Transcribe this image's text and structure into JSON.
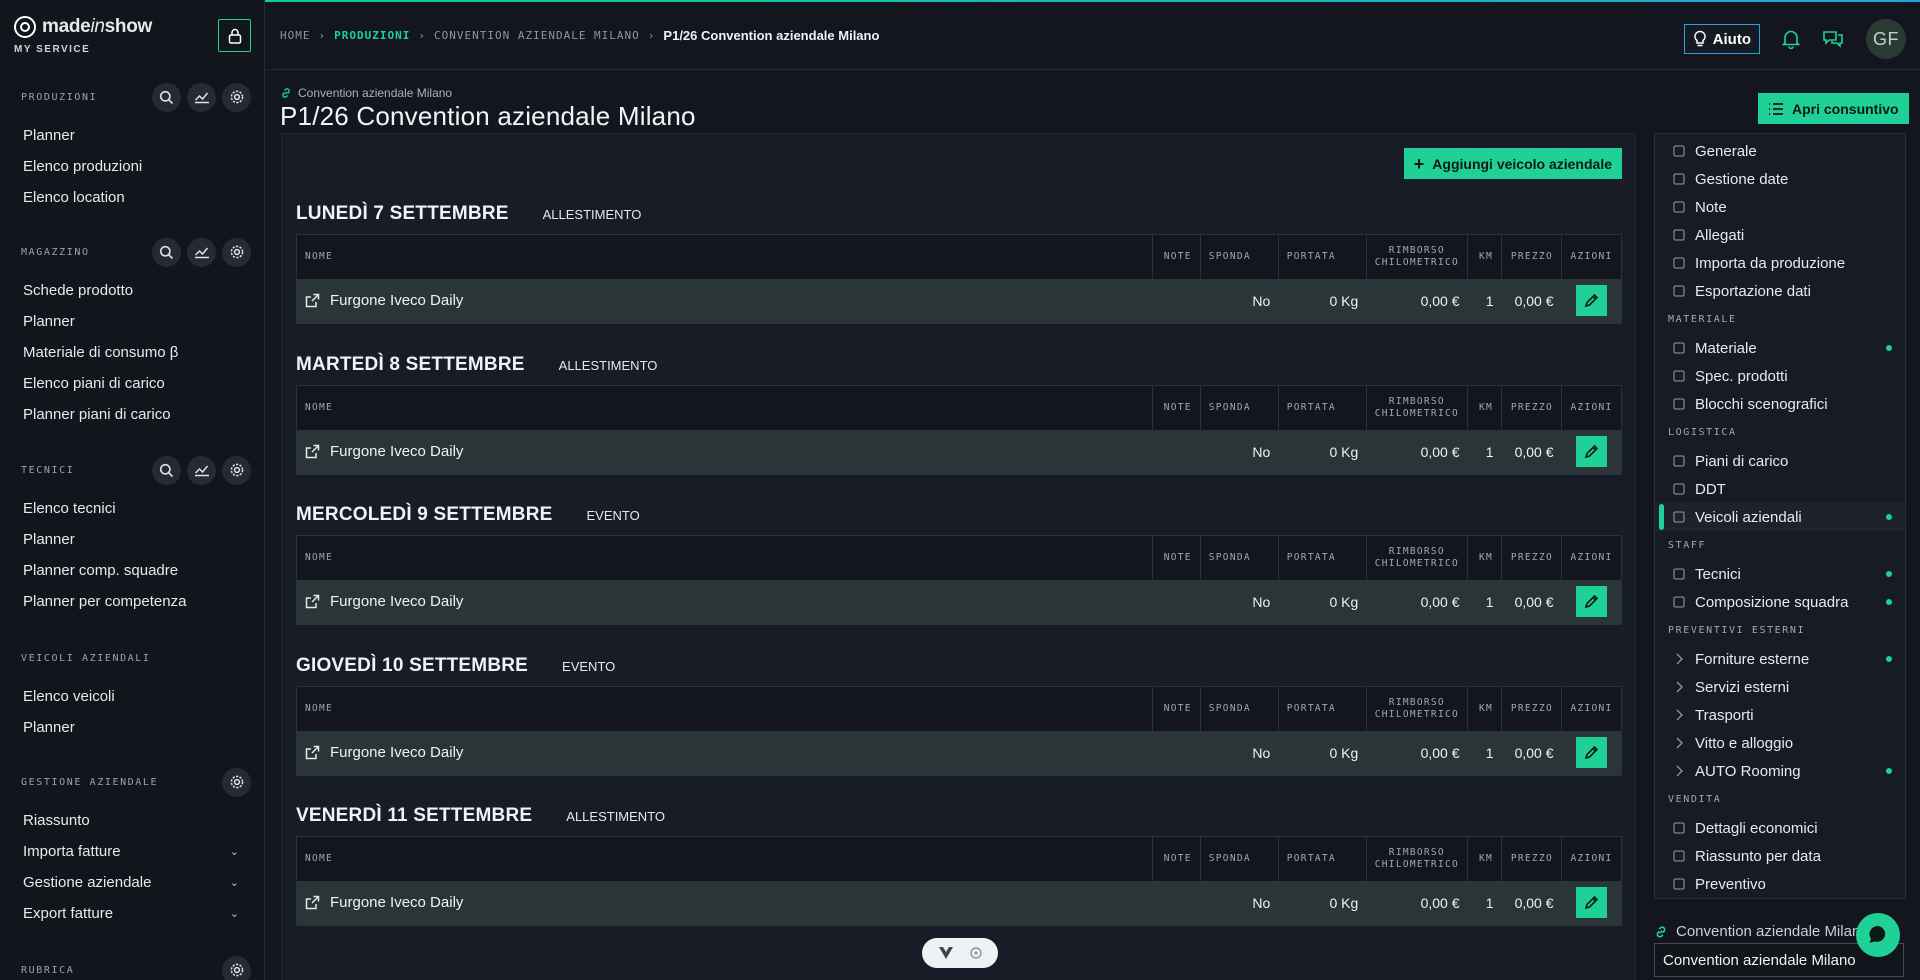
{
  "brand": {
    "name_pre": "made",
    "name_em": "in",
    "name_post": "show",
    "service": "MY SERVICE"
  },
  "colors": {
    "accent": "#1fd196",
    "help_border": "#2ba0d8",
    "background": "#13161f"
  },
  "sidebar": {
    "sections": [
      {
        "title": "PRODUZIONI",
        "actions": [
          "search-icon",
          "chart-icon",
          "gear-icon"
        ],
        "items": [
          "Planner",
          "Elenco produzioni",
          "Elenco location"
        ]
      },
      {
        "title": "MAGAZZINO",
        "actions": [
          "search-icon",
          "chart-icon",
          "gear-icon"
        ],
        "items": [
          "Schede prodotto",
          "Planner",
          "Materiale di consumo β",
          "Elenco piani di carico",
          "Planner piani di carico"
        ]
      },
      {
        "title": "TECNICI",
        "actions": [
          "search-icon",
          "chart-icon",
          "gear-icon"
        ],
        "items": [
          "Elenco tecnici",
          "Planner",
          "Planner comp. squadre",
          "Planner per competenza"
        ]
      },
      {
        "title": "VEICOLI AZIENDALI",
        "actions": [],
        "items": [
          "Elenco veicoli",
          "Planner"
        ]
      },
      {
        "title": "GESTIONE AZIENDALE",
        "actions": [
          "gear-icon"
        ],
        "items": [
          "Riassunto",
          "Importa fatture",
          "Gestione aziendale",
          "Export fatture"
        ]
      },
      {
        "title": "RUBRICA",
        "actions": [
          "gear-icon"
        ],
        "items": []
      }
    ]
  },
  "breadcrumb": {
    "home": "HOME",
    "produzioni": "PRODUZIONI",
    "event": "CONVENTION AZIENDALE MILANO",
    "current": "P1/26 Convention aziendale Milano"
  },
  "topbar": {
    "help_label": "Aiuto",
    "avatar_initials": "GF"
  },
  "page": {
    "subtitle": "Convention aziendale Milano",
    "title": "P1/26 Convention aziendale Milano",
    "apri_label": "Apri consuntivo",
    "add_label": "Aggiungi veicolo aziendale"
  },
  "table_headers": {
    "nome": "NOME",
    "note": "NOTE",
    "sponda": "SPONDA",
    "portata": "PORTATA",
    "rimborso1": "RIMBORSO",
    "rimborso2": "CHILOMETRICO",
    "km": "KM",
    "prezzo": "PREZZO",
    "azioni": "AZIONI"
  },
  "days": [
    {
      "title": "LUNEDÌ 7 SETTEMBRE",
      "phase": "ALLESTIMENTO",
      "vehicle": {
        "name": "Furgone Iveco Daily",
        "note": "",
        "sponda": "No",
        "portata": "0 Kg",
        "rimborso": "0,00 €",
        "km": "1",
        "prezzo": "0,00 €"
      }
    },
    {
      "title": "MARTEDÌ 8 SETTEMBRE",
      "phase": "ALLESTIMENTO",
      "vehicle": {
        "name": "Furgone Iveco Daily",
        "note": "",
        "sponda": "No",
        "portata": "0 Kg",
        "rimborso": "0,00 €",
        "km": "1",
        "prezzo": "0,00 €"
      }
    },
    {
      "title": "MERCOLEDÌ 9 SETTEMBRE",
      "phase": "EVENTO",
      "vehicle": {
        "name": "Furgone Iveco Daily",
        "note": "",
        "sponda": "No",
        "portata": "0 Kg",
        "rimborso": "0,00 €",
        "km": "1",
        "prezzo": "0,00 €"
      }
    },
    {
      "title": "GIOVEDÌ 10 SETTEMBRE",
      "phase": "EVENTO",
      "vehicle": {
        "name": "Furgone Iveco Daily",
        "note": "",
        "sponda": "No",
        "portata": "0 Kg",
        "rimborso": "0,00 €",
        "km": "1",
        "prezzo": "0,00 €"
      }
    },
    {
      "title": "VENERDÌ 11 SETTEMBRE",
      "phase": "ALLESTIMENTO",
      "vehicle": {
        "name": "Furgone Iveco Daily",
        "note": "",
        "sponda": "No",
        "portata": "0 Kg",
        "rimborso": "0,00 €",
        "km": "1",
        "prezzo": "0,00 €"
      }
    }
  ],
  "right_panel": {
    "groups": [
      {
        "title": "",
        "items": [
          {
            "label": "Generale",
            "icon": "tag-icon"
          },
          {
            "label": "Gestione date",
            "icon": "calendar-icon"
          },
          {
            "label": "Note",
            "icon": "note-icon"
          },
          {
            "label": "Allegati",
            "icon": "paperclip-icon"
          },
          {
            "label": "Importa da produzione",
            "icon": "import-icon"
          },
          {
            "label": "Esportazione dati",
            "icon": "export-icon"
          }
        ]
      },
      {
        "title": "MATERIALE",
        "items": [
          {
            "label": "Materiale",
            "icon": "boxes-icon",
            "dot": true
          },
          {
            "label": "Spec. prodotti",
            "icon": "file-icon"
          },
          {
            "label": "Blocchi scenografici",
            "icon": "hammer-icon"
          }
        ]
      },
      {
        "title": "LOGISTICA",
        "items": [
          {
            "label": "Piani di carico",
            "icon": "clipboard-icon"
          },
          {
            "label": "DDT",
            "icon": "dolly-icon"
          },
          {
            "label": "Veicoli aziendali",
            "icon": "truck-icon",
            "dot": true,
            "active": true
          }
        ]
      },
      {
        "title": "STAFF",
        "items": [
          {
            "label": "Tecnici",
            "icon": "user-icon",
            "dot": true
          },
          {
            "label": "Composizione squadra",
            "icon": "users-icon",
            "dot": true
          }
        ]
      },
      {
        "title": "PREVENTIVI ESTERNI",
        "items": [
          {
            "label": "Forniture esterne",
            "icon": "chevron-right-icon",
            "dot": true
          },
          {
            "label": "Servizi esterni",
            "icon": "chevron-right-icon"
          },
          {
            "label": "Trasporti",
            "icon": "chevron-right-icon"
          },
          {
            "label": "Vitto e alloggio",
            "icon": "chevron-right-icon"
          },
          {
            "label": "AUTO Rooming",
            "icon": "chevron-right-icon",
            "dot": true
          }
        ]
      },
      {
        "title": "VENDITA",
        "items": [
          {
            "label": "Dettagli economici",
            "icon": "flask-icon"
          },
          {
            "label": "Riassunto per data",
            "icon": "calendar-icon"
          },
          {
            "label": "Preventivo",
            "icon": "doc-icon"
          }
        ]
      }
    ],
    "link_label": "Convention aziendale Milano",
    "select_value": "Convention aziendale Milano"
  }
}
